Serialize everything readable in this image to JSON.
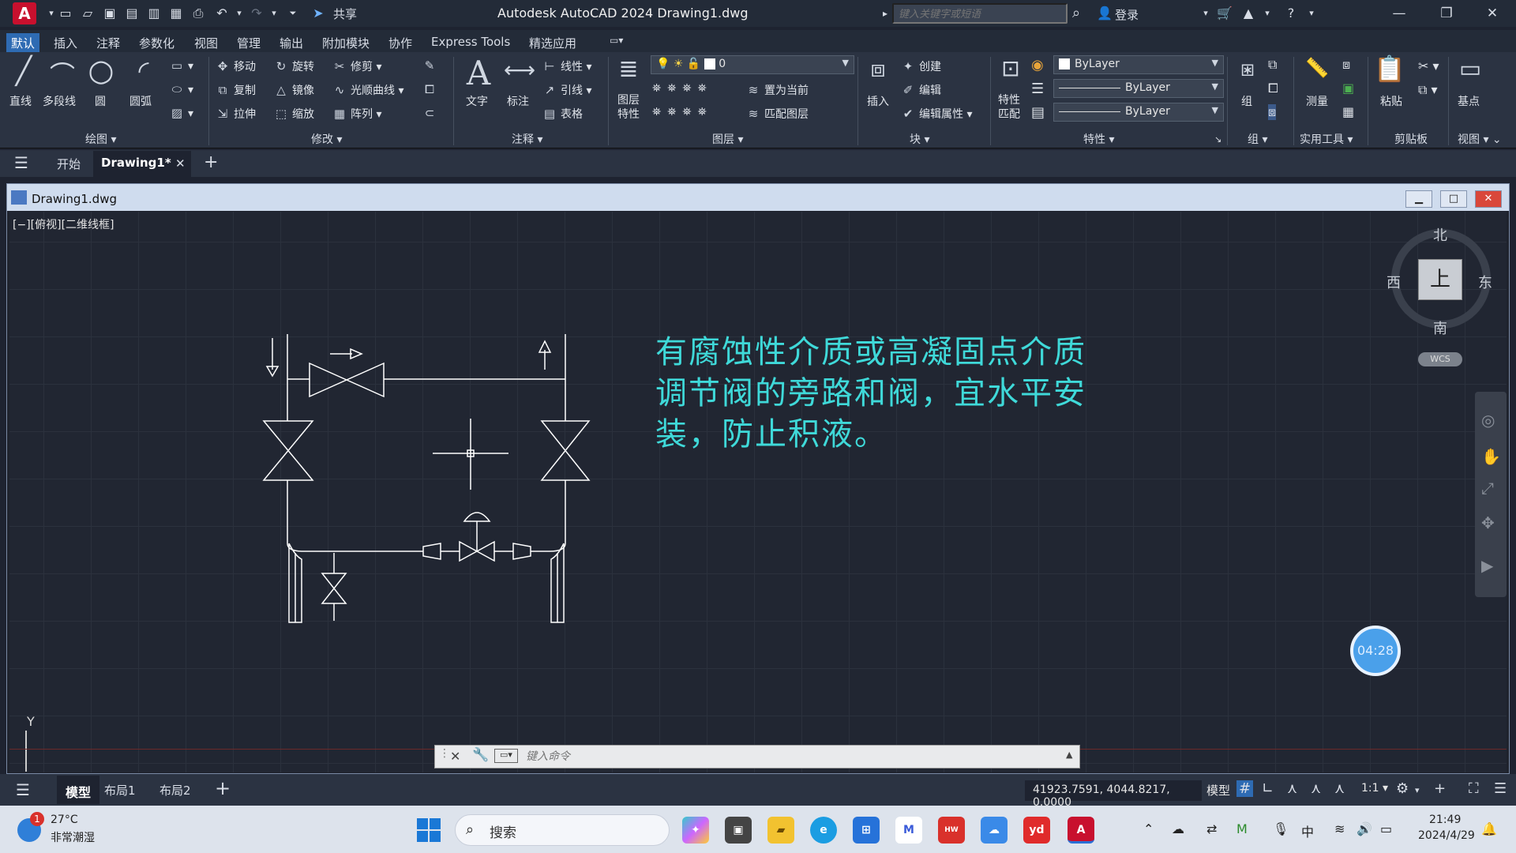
{
  "window": {
    "logo": "A",
    "title": "Autodesk AutoCAD 2024    Drawing1.dwg",
    "share": "共享",
    "search_placeholder": "键入关键字或短语",
    "login": "登录"
  },
  "ribbon_tabs": [
    "默认",
    "插入",
    "注释",
    "参数化",
    "视图",
    "管理",
    "输出",
    "附加模块",
    "协作",
    "Express Tools",
    "精选应用"
  ],
  "panels": {
    "draw": {
      "label": "绘图",
      "line": "直线",
      "polyline": "多段线",
      "circle": "圆",
      "arc": "圆弧"
    },
    "modify": {
      "label": "修改",
      "move": "移动",
      "rotate": "旋转",
      "trim": "修剪",
      "copy": "复制",
      "mirror": "镜像",
      "spline": "光顺曲线",
      "stretch": "拉伸",
      "scale": "缩放",
      "array": "阵列"
    },
    "annotation": {
      "label": "注释",
      "text": "文字",
      "dimension": "标注",
      "linear": "线性",
      "leader": "引线",
      "table": "表格"
    },
    "layers": {
      "label": "图层",
      "layer_props_line1": "图层",
      "layer_props_line2": "特性",
      "current_layer": "0",
      "set_current": "置为当前",
      "match_layer": "匹配图层"
    },
    "block": {
      "label": "块",
      "insert": "插入",
      "create": "创建",
      "edit": "编辑",
      "edit_attr": "编辑属性"
    },
    "properties": {
      "label": "特性",
      "match_line1": "特性",
      "match_line2": "匹配",
      "color": "ByLayer",
      "linetype": "ByLayer",
      "lineweight": "ByLayer"
    },
    "groups": {
      "label": "组",
      "group": "组"
    },
    "utilities": {
      "label": "实用工具",
      "measure": "测量"
    },
    "clipboard": {
      "label": "剪贴板",
      "paste": "粘贴"
    },
    "view": {
      "label": "视图",
      "base": "基点"
    }
  },
  "file_tabs": {
    "start": "开始",
    "drawing": "Drawing1*"
  },
  "drawing_window": {
    "title": "Drawing1.dwg",
    "view_label": "[−][俯视][二维线框]",
    "annotation": "有腐蚀性介质或高凝固点介质调节阀的旁路和阀，宜水平安装，防止积液。"
  },
  "viewcube": {
    "top": "上",
    "north": "北",
    "south": "南",
    "east": "东",
    "west": "西",
    "wcs": "WCS"
  },
  "timer": "04:28",
  "ucs_y": "Y",
  "command_line": {
    "placeholder": "键入命令"
  },
  "layout_tabs": [
    "模型",
    "布局1",
    "布局2"
  ],
  "status": {
    "coords": "41923.7591, 4044.8217, 0.0000",
    "space": "模型",
    "scale": "1:1"
  },
  "taskbar": {
    "weather_badge": "1",
    "temp": "27°C",
    "weather": "非常潮湿",
    "search": "搜索",
    "input_method": "中",
    "time": "21:49",
    "date": "2024/4/29"
  },
  "colors": {
    "annotation_text": "#3fd9d9",
    "active_tab": "#2e6bb3",
    "autocad_red": "#c8102e"
  }
}
